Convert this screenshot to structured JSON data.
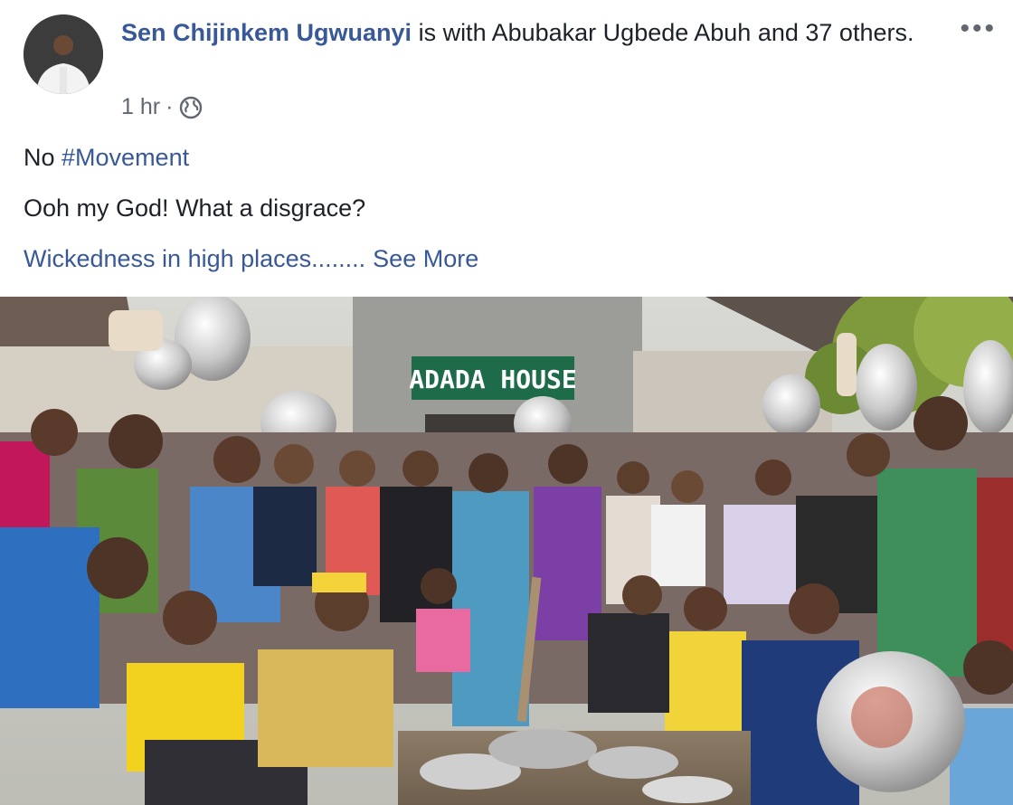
{
  "post": {
    "author": "Sen Chijinkem Ugwuanyi",
    "with_text": " is with ",
    "tagged_person": "Abubakar Ugbede Abuh",
    "and_text": " and ",
    "others_link": "37 others",
    "period": ".",
    "timestamp": "1 hr",
    "separator": " · ",
    "privacy_icon": "globe-icon",
    "more_icon": "ellipsis-icon",
    "more_label": "•••",
    "text_line_1_prefix": "No ",
    "text_line_1_hashtag": "#Movement",
    "text_line_2": "Ooh my God! What a disgrace?",
    "text_line_3": "Wickedness in high places........",
    "see_more": "See More"
  },
  "photo": {
    "sign_text": "ADADA HOUSE"
  },
  "colors": {
    "link": "#385898",
    "text": "#1d2129",
    "meta": "#616770"
  }
}
